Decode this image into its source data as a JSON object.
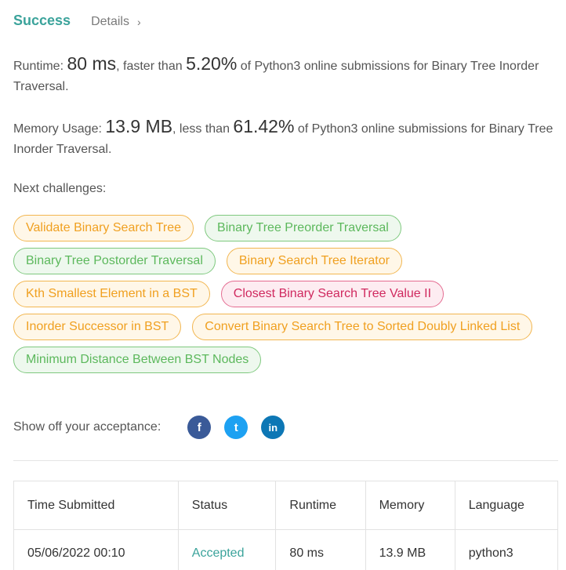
{
  "header": {
    "status": "Success",
    "details_label": "Details"
  },
  "runtime": {
    "label": "Runtime:",
    "value": "80 ms",
    "mid": ", faster than",
    "percent": "5.20%",
    "rest": "of Python3 online submissions for Binary Tree Inorder Traversal."
  },
  "memory": {
    "label": "Memory Usage:",
    "value": "13.9 MB",
    "mid": ", less than",
    "percent": "61.42%",
    "rest": "of Python3 online submissions for Binary Tree Inorder Traversal."
  },
  "next_challenges": {
    "title": "Next challenges:",
    "items": [
      {
        "label": "Validate Binary Search Tree",
        "difficulty": "medium"
      },
      {
        "label": "Binary Tree Preorder Traversal",
        "difficulty": "easy"
      },
      {
        "label": "Binary Tree Postorder Traversal",
        "difficulty": "easy"
      },
      {
        "label": "Binary Search Tree Iterator",
        "difficulty": "medium"
      },
      {
        "label": "Kth Smallest Element in a BST",
        "difficulty": "medium"
      },
      {
        "label": "Closest Binary Search Tree Value II",
        "difficulty": "hard"
      },
      {
        "label": "Inorder Successor in BST",
        "difficulty": "medium"
      },
      {
        "label": "Convert Binary Search Tree to Sorted Doubly Linked List",
        "difficulty": "medium"
      },
      {
        "label": "Minimum Distance Between BST Nodes",
        "difficulty": "easy"
      }
    ]
  },
  "share": {
    "label": "Show off your acceptance:",
    "icons": [
      {
        "name": "facebook-icon",
        "glyph": "f"
      },
      {
        "name": "twitter-icon",
        "glyph": "t"
      },
      {
        "name": "linkedin-icon",
        "glyph": "in"
      }
    ]
  },
  "submissions": {
    "columns": [
      "Time Submitted",
      "Status",
      "Runtime",
      "Memory",
      "Language"
    ],
    "rows": [
      [
        "05/06/2022 00:10",
        "Accepted",
        "80 ms",
        "13.9 MB",
        "python3"
      ]
    ]
  },
  "colors": {
    "accent": "#3ba39b",
    "medium": "#f0a020",
    "easy": "#5cb85c",
    "hard": "#d0295f"
  }
}
